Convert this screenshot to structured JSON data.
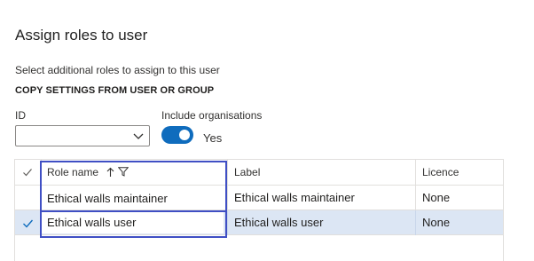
{
  "dialog": {
    "title": "Assign roles to user",
    "instruction": "Select additional roles to assign to this user",
    "section_heading": "COPY SETTINGS FROM USER OR GROUP"
  },
  "fields": {
    "id_label": "ID",
    "id_value": "",
    "include_org_label": "Include organisations",
    "include_org_state": "Yes",
    "include_org_on": true
  },
  "grid": {
    "columns": [
      "Role name",
      "Label",
      "Licence"
    ],
    "sort": "ascending",
    "rows": [
      {
        "role_name": "Ethical walls maintainer",
        "label": "Ethical walls maintainer",
        "licence": "None",
        "selected": false
      },
      {
        "role_name": "Ethical walls user",
        "label": "Ethical walls user",
        "licence": "None",
        "selected": true
      }
    ]
  },
  "colors": {
    "accent": "#0f6cbd",
    "selected_row": "#dce6f4",
    "highlight_box": "#3f4fc4"
  },
  "icons": {
    "header_check": "checkmark-icon",
    "sort": "sort-up-arrow-icon",
    "filter": "filter-icon",
    "dropdown": "chevron-down-icon",
    "row_check": "checkmark-icon"
  }
}
